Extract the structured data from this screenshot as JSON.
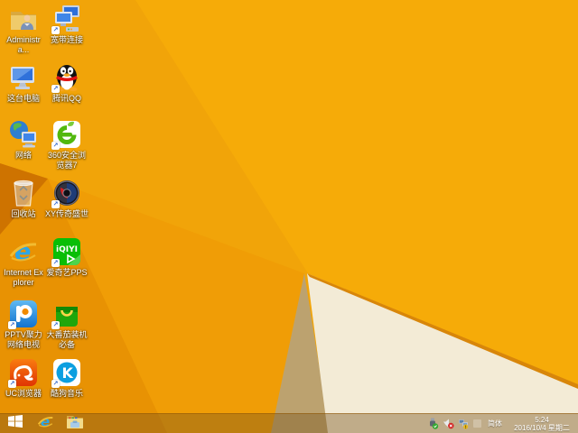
{
  "wallpaper": {
    "base": "#F1A409",
    "facet_bright": "#F6AB08",
    "facet_medium": "#E89203",
    "facet_mid2": "#F09D06",
    "wedge": "#CE7300",
    "tan_shadow": "#BCA26F",
    "cream": "#F3EBD6",
    "edge_line": "#D8860A"
  },
  "desktop": {
    "icons": [
      {
        "label": "Administra...",
        "icon": "user-folder-icon",
        "shortcut": false
      },
      {
        "label": "宽带连接",
        "icon": "broadband-connection-icon",
        "shortcut": true
      },
      {
        "label": "这台电脑",
        "icon": "this-pc-icon",
        "shortcut": false
      },
      {
        "label": "腾讯QQ",
        "icon": "qq-penguin-icon",
        "shortcut": true
      },
      {
        "label": "网络",
        "icon": "network-globe-icon",
        "shortcut": false
      },
      {
        "label": "360安全浏览器7",
        "icon": "360-browser-icon",
        "shortcut": true
      },
      {
        "label": "回收站",
        "icon": "recycle-bin-icon",
        "shortcut": false
      },
      {
        "label": "XY传奇盛世",
        "icon": "xy-game-icon",
        "shortcut": true
      },
      {
        "label": "Internet Explorer",
        "icon": "internet-explorer-icon",
        "shortcut": false
      },
      {
        "label": "爱奇艺PPS",
        "icon": "iqiyi-pps-icon",
        "shortcut": true
      },
      {
        "label": "PPTV聚力 网络电视",
        "icon": "pptv-icon",
        "shortcut": true
      },
      {
        "label": "大番茄装机必备",
        "icon": "tomato-bag-icon",
        "shortcut": true
      },
      {
        "label": "UC浏览器",
        "icon": "uc-browser-icon",
        "shortcut": true
      },
      {
        "label": "酷狗音乐",
        "icon": "kugou-music-icon",
        "shortcut": true
      }
    ]
  },
  "taskbar": {
    "start_icon": "windows-start-icon",
    "pinned": [
      "internet-explorer-icon",
      "file-explorer-icon"
    ],
    "tray": {
      "icons": [
        "usb-safely-remove-icon",
        "volume-muted-icon",
        "network-warning-icon",
        "hidden-tray-icon"
      ],
      "ime_label": "简体",
      "time": "5:24",
      "date": "2016/10/4 星期二"
    }
  }
}
